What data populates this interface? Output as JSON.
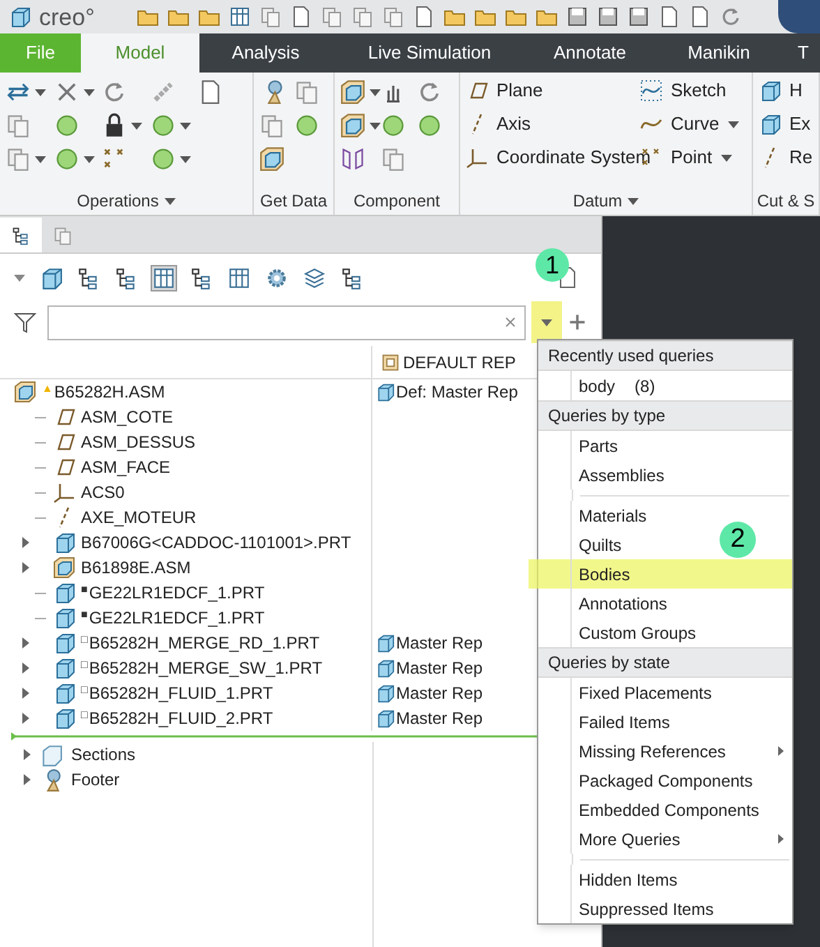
{
  "quick_access": {
    "logo": "creo°"
  },
  "ribbon_tabs": [
    {
      "label": "File",
      "kind": "file",
      "selected": false
    },
    {
      "label": "Model",
      "kind": "tab",
      "selected": true
    },
    {
      "label": "Analysis",
      "kind": "tab",
      "selected": false
    },
    {
      "label": "Live Simulation",
      "kind": "tab",
      "selected": false
    },
    {
      "label": "Annotate",
      "kind": "tab",
      "selected": false
    },
    {
      "label": "Manikin",
      "kind": "tab",
      "selected": false
    },
    {
      "label": "T",
      "kind": "tab",
      "selected": false
    }
  ],
  "ribbon_groups": [
    {
      "label": "Operations",
      "menu": true,
      "kind": "icons"
    },
    {
      "label": "Get Data",
      "menu": false,
      "kind": "icons"
    },
    {
      "label": "Component",
      "menu": false,
      "kind": "icons"
    },
    {
      "label": "Datum",
      "menu": true,
      "kind": "commands",
      "commands": [
        {
          "label": "Plane",
          "menu": false
        },
        {
          "label": "Sketch",
          "menu": false
        },
        {
          "label": "Axis",
          "menu": false
        },
        {
          "label": "Curve",
          "menu": true
        },
        {
          "label": "Coordinate System",
          "menu": false
        },
        {
          "label": "Point",
          "menu": true
        }
      ]
    },
    {
      "label": "Cut & S",
      "menu": false,
      "kind": "commands",
      "commands": [
        {
          "label": "H",
          "menu": false
        },
        {
          "label": "Ex",
          "menu": false
        },
        {
          "label": "Re",
          "menu": false
        }
      ]
    }
  ],
  "model_tree": {
    "tabs": [
      {
        "selected": true
      },
      {
        "selected": false
      }
    ],
    "filter": {
      "dropdown_highlighted": true,
      "callout": "1"
    },
    "columns": [
      "DEFAULT REP"
    ],
    "rows": [
      {
        "label": "B65282H.ASM",
        "kind": "assembly",
        "marker": "▲",
        "rep": "Def: Master Rep",
        "expandable": false,
        "children": [
          {
            "label": "ASM_COTE",
            "kind": "plane",
            "expandable": false
          },
          {
            "label": "ASM_DESSUS",
            "kind": "plane",
            "expandable": false
          },
          {
            "label": "ASM_FACE",
            "kind": "plane",
            "expandable": false
          },
          {
            "label": "ACS0",
            "kind": "csys",
            "expandable": false
          },
          {
            "label": "AXE_MOTEUR",
            "kind": "axis",
            "expandable": false
          },
          {
            "label": "B67006G<CADDOC-1101001>.PRT",
            "kind": "part",
            "expandable": true
          },
          {
            "label": "B61898E.ASM",
            "kind": "assembly",
            "expandable": true
          },
          {
            "label": "GE22LR1EDCF_1.PRT",
            "kind": "part",
            "marker": "■",
            "expandable": false
          },
          {
            "label": "GE22LR1EDCF_1.PRT",
            "kind": "part",
            "marker": "■",
            "expandable": false
          },
          {
            "label": "B65282H_MERGE_RD_1.PRT",
            "kind": "part",
            "marker": "□",
            "rep": "Master Rep",
            "expandable": true
          },
          {
            "label": "B65282H_MERGE_SW_1.PRT",
            "kind": "part",
            "marker": "□",
            "rep": "Master Rep",
            "expandable": true
          },
          {
            "label": "B65282H_FLUID_1.PRT",
            "kind": "part",
            "marker": "□",
            "rep": "Master Rep",
            "expandable": true
          },
          {
            "label": "B65282H_FLUID_2.PRT",
            "kind": "part",
            "marker": "□",
            "rep": "Master Rep",
            "expandable": true
          }
        ]
      }
    ],
    "sections": [
      {
        "label": "Sections",
        "kind": "sections",
        "expandable": true
      },
      {
        "label": "Footer",
        "kind": "footer",
        "expandable": true
      }
    ]
  },
  "query_menu": {
    "sections": [
      {
        "header": "Recently used queries",
        "items": [
          {
            "kind": "item",
            "label": "body",
            "count": "(8)",
            "submenu": false,
            "highlighted": false
          }
        ]
      },
      {
        "header": "Queries by type",
        "items": [
          {
            "kind": "item",
            "label": "Parts",
            "submenu": false,
            "highlighted": false
          },
          {
            "kind": "item",
            "label": "Assemblies",
            "submenu": false,
            "highlighted": false
          },
          {
            "kind": "separator"
          },
          {
            "kind": "item",
            "label": "Materials",
            "submenu": false,
            "highlighted": false
          },
          {
            "kind": "item",
            "label": "Quilts",
            "submenu": false,
            "highlighted": false
          },
          {
            "kind": "item",
            "label": "Bodies",
            "submenu": false,
            "highlighted": true,
            "callout": "2"
          },
          {
            "kind": "item",
            "label": "Annotations",
            "submenu": false,
            "highlighted": false
          },
          {
            "kind": "item",
            "label": "Custom Groups",
            "submenu": false,
            "highlighted": false
          }
        ]
      },
      {
        "header": "Queries by state",
        "items": [
          {
            "kind": "item",
            "label": "Fixed Placements",
            "submenu": false,
            "highlighted": false
          },
          {
            "kind": "item",
            "label": "Failed Items",
            "submenu": false,
            "highlighted": false
          },
          {
            "kind": "item",
            "label": "Missing References",
            "submenu": true,
            "highlighted": false
          },
          {
            "kind": "item",
            "label": "Packaged Components",
            "submenu": false,
            "highlighted": false
          },
          {
            "kind": "item",
            "label": "Embedded Components",
            "submenu": false,
            "highlighted": false
          },
          {
            "kind": "item",
            "label": "More Queries",
            "submenu": true,
            "highlighted": false
          },
          {
            "kind": "separator"
          },
          {
            "kind": "item",
            "label": "Hidden Items",
            "submenu": false,
            "highlighted": false
          },
          {
            "kind": "item",
            "label": "Suppressed Items",
            "submenu": false,
            "highlighted": false
          }
        ]
      }
    ]
  }
}
